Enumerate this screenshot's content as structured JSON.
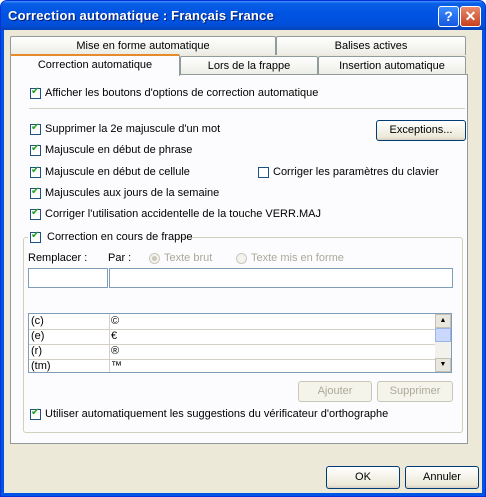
{
  "window": {
    "title": "Correction automatique : Français France"
  },
  "titlebar": {
    "help_label": "?",
    "close_label": "✕"
  },
  "tabs": {
    "row1": [
      "Mise en forme automatique",
      "Balises actives"
    ],
    "row2": [
      "Correction automatique",
      "Lors de la frappe",
      "Insertion automatique"
    ],
    "active": "Correction automatique"
  },
  "options": {
    "show_buttons": "Afficher les boutons d'options de correction automatique",
    "two_initial_caps": "Supprimer la 2e majuscule d'un mot",
    "capitalize_sentence": "Majuscule en début de phrase",
    "capitalize_cell": "Majuscule en début de cellule",
    "capitalize_days": "Majuscules aux jours de la semaine",
    "caps_lock": "Corriger l'utilisation accidentelle de la touche VERR.MAJ",
    "keyboard_settings": "Corriger les paramètres du clavier",
    "exceptions_button": "Exceptions..."
  },
  "replace_group": {
    "title": "Correction en cours de frappe",
    "replace_label": "Remplacer :",
    "with_label": "Par :",
    "plain_text": "Texte brut",
    "formatted_text": "Texte mis en forme",
    "replace_value": "",
    "with_value": "",
    "rows": [
      {
        "from": "(c)",
        "to": "©"
      },
      {
        "from": "(e)",
        "to": "€"
      },
      {
        "from": "(r)",
        "to": "®"
      },
      {
        "from": "(tm)",
        "to": "™"
      }
    ],
    "add_button": "Ajouter",
    "delete_button": "Supprimer",
    "spell_suggest": "Utiliser automatiquement les suggestions du vérificateur d'orthographe"
  },
  "footer": {
    "ok": "OK",
    "cancel": "Annuler"
  }
}
